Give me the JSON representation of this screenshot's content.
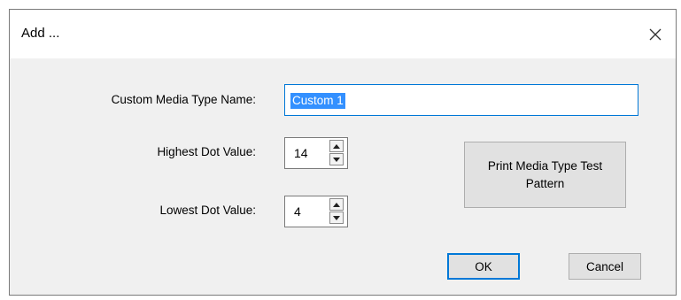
{
  "dialog": {
    "title": "Add ...",
    "close_symbol": "✕"
  },
  "fields": {
    "name_label": "Custom Media Type Name:",
    "name_value": "Custom 1",
    "highest_label": "Highest Dot Value:",
    "highest_value": "14",
    "lowest_label": "Lowest Dot Value:",
    "lowest_value": "4"
  },
  "buttons": {
    "print_test_pattern": "Print Media Type Test Pattern",
    "ok": "OK",
    "cancel": "Cancel"
  },
  "icons": {
    "close": "close-icon",
    "spin_up": "up-arrow-icon",
    "spin_down": "down-arrow-icon"
  },
  "colors": {
    "focus_border": "#0078d7",
    "selection": "#3390ff",
    "button_face": "#e1e1e1",
    "dialog_bg": "#f0f0f0"
  }
}
